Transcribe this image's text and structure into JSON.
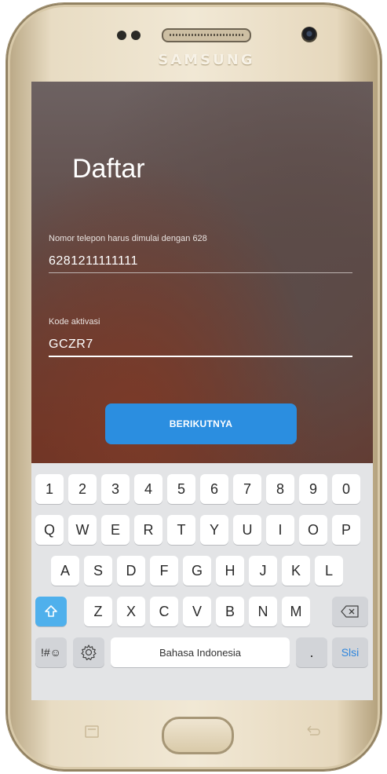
{
  "device": {
    "brand": "SAMSUNG"
  },
  "screen": {
    "title": "Daftar",
    "phone": {
      "label": "Nomor telepon harus dimulai dengan 628",
      "value": "6281211111111"
    },
    "code": {
      "label": "Kode aktivasi",
      "value": "GCZR7"
    },
    "next_button": "BERIKUTNYA"
  },
  "keyboard": {
    "row_numbers": [
      "1",
      "2",
      "3",
      "4",
      "5",
      "6",
      "7",
      "8",
      "9",
      "0"
    ],
    "row_top": [
      "Q",
      "W",
      "E",
      "R",
      "T",
      "Y",
      "U",
      "I",
      "O",
      "P"
    ],
    "row_middle": [
      "A",
      "S",
      "D",
      "F",
      "G",
      "H",
      "J",
      "K",
      "L"
    ],
    "row_bottom": [
      "Z",
      "X",
      "C",
      "V",
      "B",
      "N",
      "M"
    ],
    "symbols_key": "!#☺",
    "space_label": "Bahasa Indonesia",
    "period_key": ".",
    "action_key": "Slsi"
  },
  "colors": {
    "accent": "#2b8ee0",
    "shift_active": "#4fb0ec",
    "action_text": "#2f86dd"
  }
}
